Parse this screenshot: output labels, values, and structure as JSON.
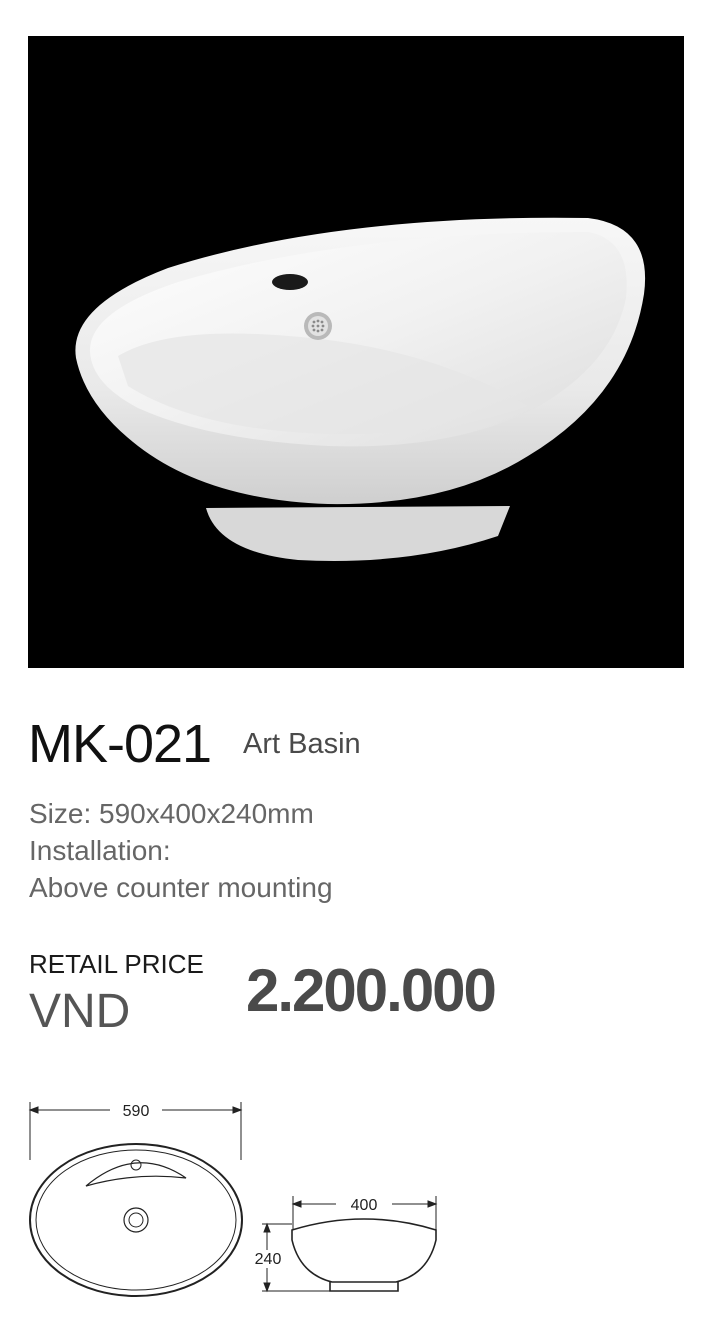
{
  "product": {
    "model": "MK-021",
    "type": "Art Basin",
    "size": "Size: 590x400x240mm",
    "installation_label": "Installation:",
    "installation_value": "Above counter mounting"
  },
  "price": {
    "label": "RETAIL PRICE",
    "currency": "VND",
    "value": "2.200.000"
  },
  "drawing": {
    "width": "590",
    "depth": "400",
    "height": "240"
  }
}
